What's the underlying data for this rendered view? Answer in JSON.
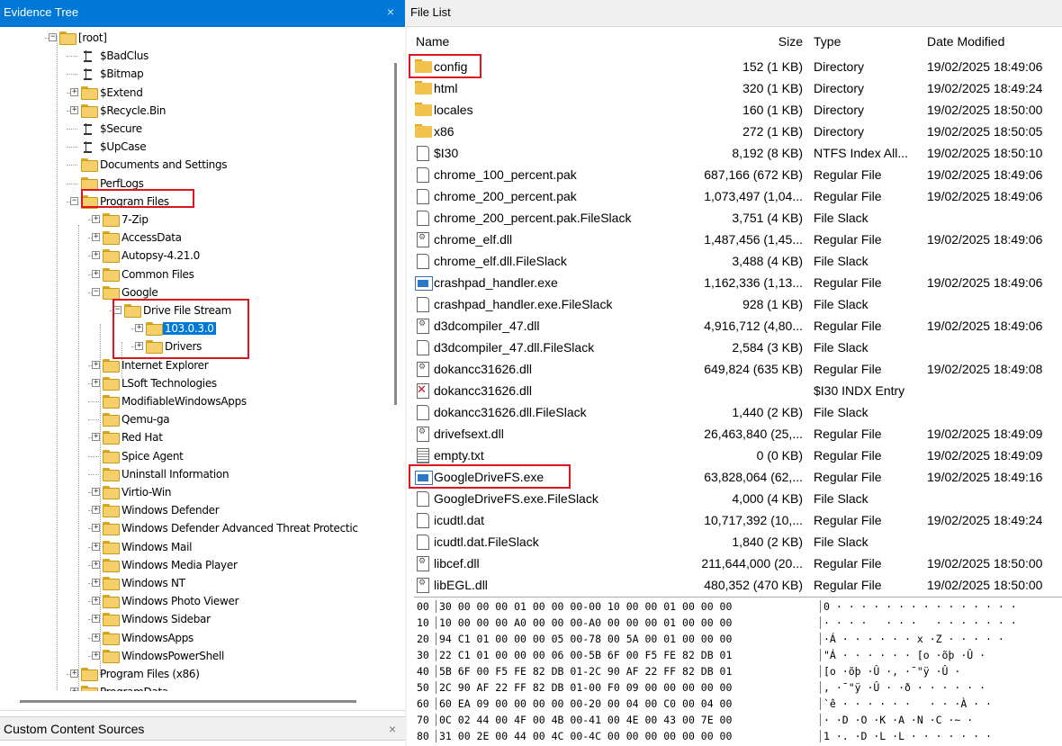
{
  "left_panel": {
    "title": "Evidence Tree",
    "close_symbol": "×",
    "bottom_panel_title": "Custom Content Sources"
  },
  "tree": [
    {
      "label": "[root]",
      "depth": 0,
      "icon": "folder",
      "expander": "−"
    },
    {
      "label": "$BadClus",
      "depth": 1,
      "icon": "attr",
      "expander": ""
    },
    {
      "label": "$Bitmap",
      "depth": 1,
      "icon": "attr",
      "expander": ""
    },
    {
      "label": "$Extend",
      "depth": 1,
      "icon": "folder",
      "expander": "+"
    },
    {
      "label": "$Recycle.Bin",
      "depth": 1,
      "icon": "folder",
      "expander": "+"
    },
    {
      "label": "$Secure",
      "depth": 1,
      "icon": "attr",
      "expander": ""
    },
    {
      "label": "$UpCase",
      "depth": 1,
      "icon": "attr",
      "expander": ""
    },
    {
      "label": "Documents and Settings",
      "depth": 1,
      "icon": "folder",
      "expander": ""
    },
    {
      "label": "PerfLogs",
      "depth": 1,
      "icon": "folder",
      "expander": ""
    },
    {
      "label": "Program Files",
      "depth": 1,
      "icon": "folder",
      "expander": "−"
    },
    {
      "label": "7-Zip",
      "depth": 2,
      "icon": "folder",
      "expander": "+"
    },
    {
      "label": "AccessData",
      "depth": 2,
      "icon": "folder",
      "expander": "+"
    },
    {
      "label": "Autopsy-4.21.0",
      "depth": 2,
      "icon": "folder",
      "expander": "+"
    },
    {
      "label": "Common Files",
      "depth": 2,
      "icon": "folder",
      "expander": "+"
    },
    {
      "label": "Google",
      "depth": 2,
      "icon": "folder",
      "expander": "−"
    },
    {
      "label": "Drive File Stream",
      "depth": 3,
      "icon": "folder",
      "expander": "−"
    },
    {
      "label": "103.0.3.0",
      "depth": 4,
      "icon": "folder",
      "expander": "+",
      "selected": true
    },
    {
      "label": "Drivers",
      "depth": 4,
      "icon": "folder",
      "expander": "+"
    },
    {
      "label": "Internet Explorer",
      "depth": 2,
      "icon": "folder",
      "expander": "+"
    },
    {
      "label": "LSoft Technologies",
      "depth": 2,
      "icon": "folder",
      "expander": "+"
    },
    {
      "label": "ModifiableWindowsApps",
      "depth": 2,
      "icon": "folder",
      "expander": ""
    },
    {
      "label": "Qemu-ga",
      "depth": 2,
      "icon": "folder",
      "expander": ""
    },
    {
      "label": "Red Hat",
      "depth": 2,
      "icon": "folder",
      "expander": "+"
    },
    {
      "label": "Spice Agent",
      "depth": 2,
      "icon": "folder",
      "expander": ""
    },
    {
      "label": "Uninstall Information",
      "depth": 2,
      "icon": "folder",
      "expander": ""
    },
    {
      "label": "Virtio-Win",
      "depth": 2,
      "icon": "folder",
      "expander": "+"
    },
    {
      "label": "Windows Defender",
      "depth": 2,
      "icon": "folder",
      "expander": "+"
    },
    {
      "label": "Windows Defender Advanced Threat Protectic",
      "depth": 2,
      "icon": "folder",
      "expander": "+"
    },
    {
      "label": "Windows Mail",
      "depth": 2,
      "icon": "folder",
      "expander": "+"
    },
    {
      "label": "Windows Media Player",
      "depth": 2,
      "icon": "folder",
      "expander": "+"
    },
    {
      "label": "Windows NT",
      "depth": 2,
      "icon": "folder",
      "expander": "+"
    },
    {
      "label": "Windows Photo Viewer",
      "depth": 2,
      "icon": "folder",
      "expander": "+"
    },
    {
      "label": "Windows Sidebar",
      "depth": 2,
      "icon": "folder",
      "expander": "+"
    },
    {
      "label": "WindowsApps",
      "depth": 2,
      "icon": "folder",
      "expander": "+"
    },
    {
      "label": "WindowsPowerShell",
      "depth": 2,
      "icon": "folder",
      "expander": "+"
    },
    {
      "label": "Program Files (x86)",
      "depth": 1,
      "icon": "folder",
      "expander": "+"
    },
    {
      "label": "ProgramData",
      "depth": 1,
      "icon": "folder",
      "expander": "+"
    }
  ],
  "file_list": {
    "title": "File List",
    "columns": {
      "name": "Name",
      "size": "Size",
      "type": "Type",
      "date": "Date Modified"
    },
    "rows": [
      {
        "name": "config",
        "size": "152 (1 KB)",
        "type": "Directory",
        "date": "19/02/2025 18:49:06",
        "icon": "folder"
      },
      {
        "name": "html",
        "size": "320 (1 KB)",
        "type": "Directory",
        "date": "19/02/2025 18:49:24",
        "icon": "folder"
      },
      {
        "name": "locales",
        "size": "160 (1 KB)",
        "type": "Directory",
        "date": "19/02/2025 18:50:00",
        "icon": "folder"
      },
      {
        "name": "x86",
        "size": "272 (1 KB)",
        "type": "Directory",
        "date": "19/02/2025 18:50:05",
        "icon": "folder"
      },
      {
        "name": "$I30",
        "size": "8,192 (8 KB)",
        "type": "NTFS Index All...",
        "date": "19/02/2025 18:50:10",
        "icon": "doc"
      },
      {
        "name": "chrome_100_percent.pak",
        "size": "687,166 (672 KB)",
        "type": "Regular File",
        "date": "19/02/2025 18:49:06",
        "icon": "doc"
      },
      {
        "name": "chrome_200_percent.pak",
        "size": "1,073,497 (1,04...",
        "type": "Regular File",
        "date": "19/02/2025 18:49:06",
        "icon": "doc"
      },
      {
        "name": "chrome_200_percent.pak.FileSlack",
        "size": "3,751 (4 KB)",
        "type": "File Slack",
        "date": "",
        "icon": "doc"
      },
      {
        "name": "chrome_elf.dll",
        "size": "1,487,456 (1,45...",
        "type": "Regular File",
        "date": "19/02/2025 18:49:06",
        "icon": "dll"
      },
      {
        "name": "chrome_elf.dll.FileSlack",
        "size": "3,488 (4 KB)",
        "type": "File Slack",
        "date": "",
        "icon": "doc"
      },
      {
        "name": "crashpad_handler.exe",
        "size": "1,162,336 (1,13...",
        "type": "Regular File",
        "date": "19/02/2025 18:49:06",
        "icon": "exe"
      },
      {
        "name": "crashpad_handler.exe.FileSlack",
        "size": "928 (1 KB)",
        "type": "File Slack",
        "date": "",
        "icon": "doc"
      },
      {
        "name": "d3dcompiler_47.dll",
        "size": "4,916,712 (4,80...",
        "type": "Regular File",
        "date": "19/02/2025 18:49:06",
        "icon": "dll"
      },
      {
        "name": "d3dcompiler_47.dll.FileSlack",
        "size": "2,584 (3 KB)",
        "type": "File Slack",
        "date": "",
        "icon": "doc"
      },
      {
        "name": "dokancc31626.dll",
        "size": "649,824 (635 KB)",
        "type": "Regular File",
        "date": "19/02/2025 18:49:08",
        "icon": "dll"
      },
      {
        "name": "dokancc31626.dll",
        "size": "",
        "type": "$I30 INDX Entry",
        "date": "",
        "icon": "deleted"
      },
      {
        "name": "dokancc31626.dll.FileSlack",
        "size": "1,440 (2 KB)",
        "type": "File Slack",
        "date": "",
        "icon": "doc"
      },
      {
        "name": "drivefsext.dll",
        "size": "26,463,840 (25,...",
        "type": "Regular File",
        "date": "19/02/2025 18:49:09",
        "icon": "dll"
      },
      {
        "name": "empty.txt",
        "size": "0 (0 KB)",
        "type": "Regular File",
        "date": "19/02/2025 18:49:09",
        "icon": "txt"
      },
      {
        "name": "GoogleDriveFS.exe",
        "size": "63,828,064 (62,...",
        "type": "Regular File",
        "date": "19/02/2025 18:49:16",
        "icon": "exe"
      },
      {
        "name": "GoogleDriveFS.exe.FileSlack",
        "size": "4,000 (4 KB)",
        "type": "File Slack",
        "date": "",
        "icon": "doc"
      },
      {
        "name": "icudtl.dat",
        "size": "10,717,392 (10,...",
        "type": "Regular File",
        "date": "19/02/2025 18:49:24",
        "icon": "doc"
      },
      {
        "name": "icudtl.dat.FileSlack",
        "size": "1,840 (2 KB)",
        "type": "File Slack",
        "date": "",
        "icon": "doc"
      },
      {
        "name": "libcef.dll",
        "size": "211,644,000 (20...",
        "type": "Regular File",
        "date": "19/02/2025 18:50:00",
        "icon": "dll"
      },
      {
        "name": "libEGL.dll",
        "size": "480,352 (470 KB)",
        "type": "Regular File",
        "date": "19/02/2025 18:50:00",
        "icon": "dll"
      }
    ]
  },
  "hex_view": [
    {
      "offset": "00",
      "bytes": "30 00 00 00 01 00 00 00-00 10 00 00 01 00 00 00",
      "ascii": "0 · · · · · · · · · · · · · · ·"
    },
    {
      "offset": "10",
      "bytes": "10 00 00 00 A0 00 00 00-A0 00 00 00 01 00 00 00",
      "ascii": "· · · ·   · · ·   · · · · · · ·"
    },
    {
      "offset": "20",
      "bytes": "94 C1 01 00 00 00 05 00-78 00 5A 00 01 00 00 00",
      "ascii": "·Á · · · · · · x ·Z · · · · ·"
    },
    {
      "offset": "30",
      "bytes": "22 C1 01 00 00 00 06 00-5B 6F 00 F5 FE 82 DB 01",
      "ascii": "\"Á · · · · · · [o ·õþ ·Û ·"
    },
    {
      "offset": "40",
      "bytes": "5B 6F 00 F5 FE 82 DB 01-2C 90 AF 22 FF 82 DB 01",
      "ascii": "[o ·õþ ·Û ·, ·¯\"ÿ ·Û ·"
    },
    {
      "offset": "50",
      "bytes": "2C 90 AF 22 FF 82 DB 01-00 F0 09 00 00 00 00 00",
      "ascii": ", ·¯\"ÿ ·Û · ·ð · · · · · ·"
    },
    {
      "offset": "60",
      "bytes": "60 EA 09 00 00 00 00 00-20 00 04 00 C0 00 04 00",
      "ascii": "`ê · · · · · ·   · · ·À · ·"
    },
    {
      "offset": "70",
      "bytes": "0C 02 44 00 4F 00 4B 00-41 00 4E 00 43 00 7E 00",
      "ascii": "· ·D ·O ·K ·A ·N ·C ·~ ·"
    },
    {
      "offset": "80",
      "bytes": "31 00 2E 00 44 00 4C 00-4C 00 00 00 00 00 00 00",
      "ascii": "1 ·. ·D ·L ·L · · · · · · ·"
    }
  ]
}
